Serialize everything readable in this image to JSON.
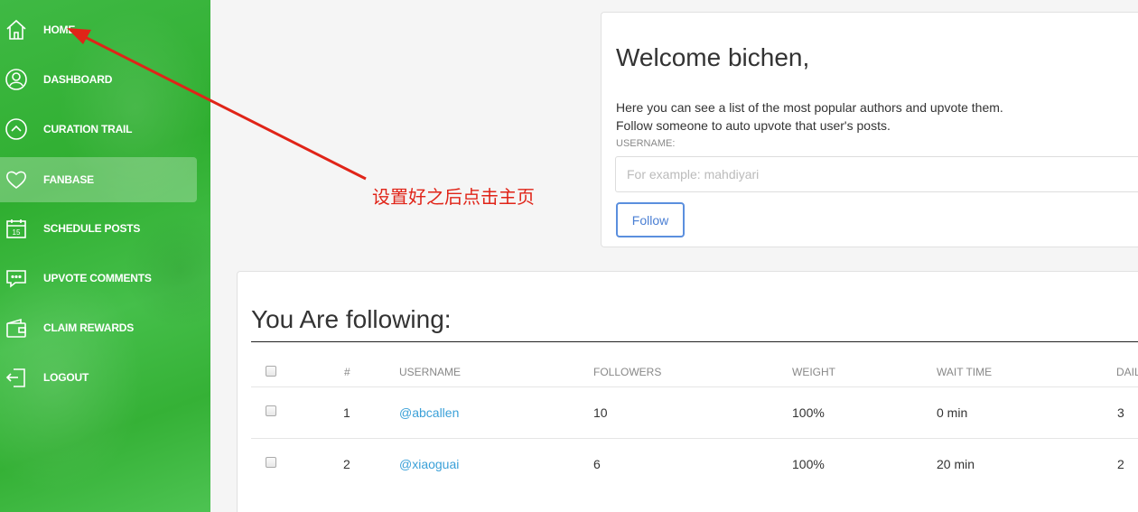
{
  "sidebar": {
    "items": [
      {
        "label": "HOME",
        "icon": "home-icon"
      },
      {
        "label": "DASHBOARD",
        "icon": "user-circle-icon"
      },
      {
        "label": "CURATION TRAIL",
        "icon": "chevron-up-circle-icon"
      },
      {
        "label": "FANBASE",
        "icon": "heart-icon",
        "active": true
      },
      {
        "label": "SCHEDULE POSTS",
        "icon": "calendar-icon",
        "icon_text": "15"
      },
      {
        "label": "UPVOTE COMMENTS",
        "icon": "comment-icon"
      },
      {
        "label": "CLAIM REWARDS",
        "icon": "wallet-icon"
      },
      {
        "label": "LOGOUT",
        "icon": "logout-icon"
      }
    ]
  },
  "welcome": {
    "title": "Welcome bichen,",
    "line1": "Here you can see a list of the most popular authors and upvote them.",
    "line2": "Follow someone to auto upvote that user's posts.",
    "username_label": "USERNAME:",
    "username_placeholder": "For example: mahdiyari",
    "username_value": "",
    "follow_label": "Follow"
  },
  "following": {
    "title": "You Are following:",
    "columns": [
      "#",
      "USERNAME",
      "FOLLOWERS",
      "WEIGHT",
      "WAIT TIME",
      "DAIL"
    ],
    "rows": [
      {
        "num": "1",
        "username": "@abcallen",
        "followers": "10",
        "weight": "100%",
        "wait": "0 min",
        "daily": "3"
      },
      {
        "num": "2",
        "username": "@xiaoguai",
        "followers": "6",
        "weight": "100%",
        "wait": "20 min",
        "daily": "2"
      }
    ]
  },
  "annotation": {
    "text": "设置好之后点击主页",
    "color": "#e02418"
  },
  "colors": {
    "sidebar_green": "#2fae30",
    "link": "#3aa0d8",
    "follow_border": "#5b8fde"
  }
}
